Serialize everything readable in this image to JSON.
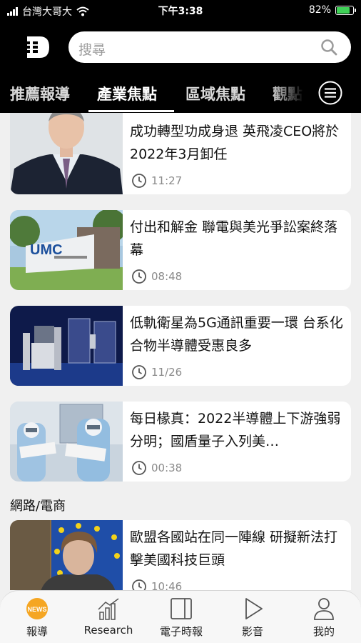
{
  "status_bar": {
    "carrier": "台灣大哥大",
    "time": "下午3:38",
    "battery": "82%",
    "battery_level": 0.82
  },
  "search": {
    "placeholder": "搜尋"
  },
  "tabs": [
    {
      "label": "推薦報導",
      "active": false
    },
    {
      "label": "產業焦點",
      "active": true
    },
    {
      "label": "區域焦點",
      "active": false
    },
    {
      "label": "觀點",
      "active": false
    }
  ],
  "articles": [
    {
      "title": "成功轉型功成身退 英飛凌CEO將於2022年3月卸任",
      "time": "11:27"
    },
    {
      "title": "付出和解金 聯電與美光爭訟案終落幕",
      "time": "08:48",
      "image_text": "UMC"
    },
    {
      "title": "低軌衛星為5G通訊重要一環 台系化合物半導體受惠良多",
      "time": "11/26"
    },
    {
      "title": "每日椽真：2022半導體上下游強弱分明；國盾量子入列美…",
      "time": "00:38"
    },
    {
      "title": "歐盟各國站在同一陣線 研擬新法打擊美國科技巨頭",
      "time": "10:46"
    }
  ],
  "section": {
    "label": "網路/電商"
  },
  "bottom_nav": [
    {
      "label": "報導",
      "icon": "news-icon",
      "active": true,
      "badge": "NEWS"
    },
    {
      "label": "Research",
      "icon": "chart-icon",
      "active": false
    },
    {
      "label": "電子時報",
      "icon": "tablet-icon",
      "active": false
    },
    {
      "label": "影音",
      "icon": "play-icon",
      "active": false
    },
    {
      "label": "我的",
      "icon": "user-icon",
      "active": false
    }
  ],
  "colors": {
    "accent": "#f5a623",
    "header_bg": "#000000",
    "content_bg": "#f0f0f0"
  }
}
